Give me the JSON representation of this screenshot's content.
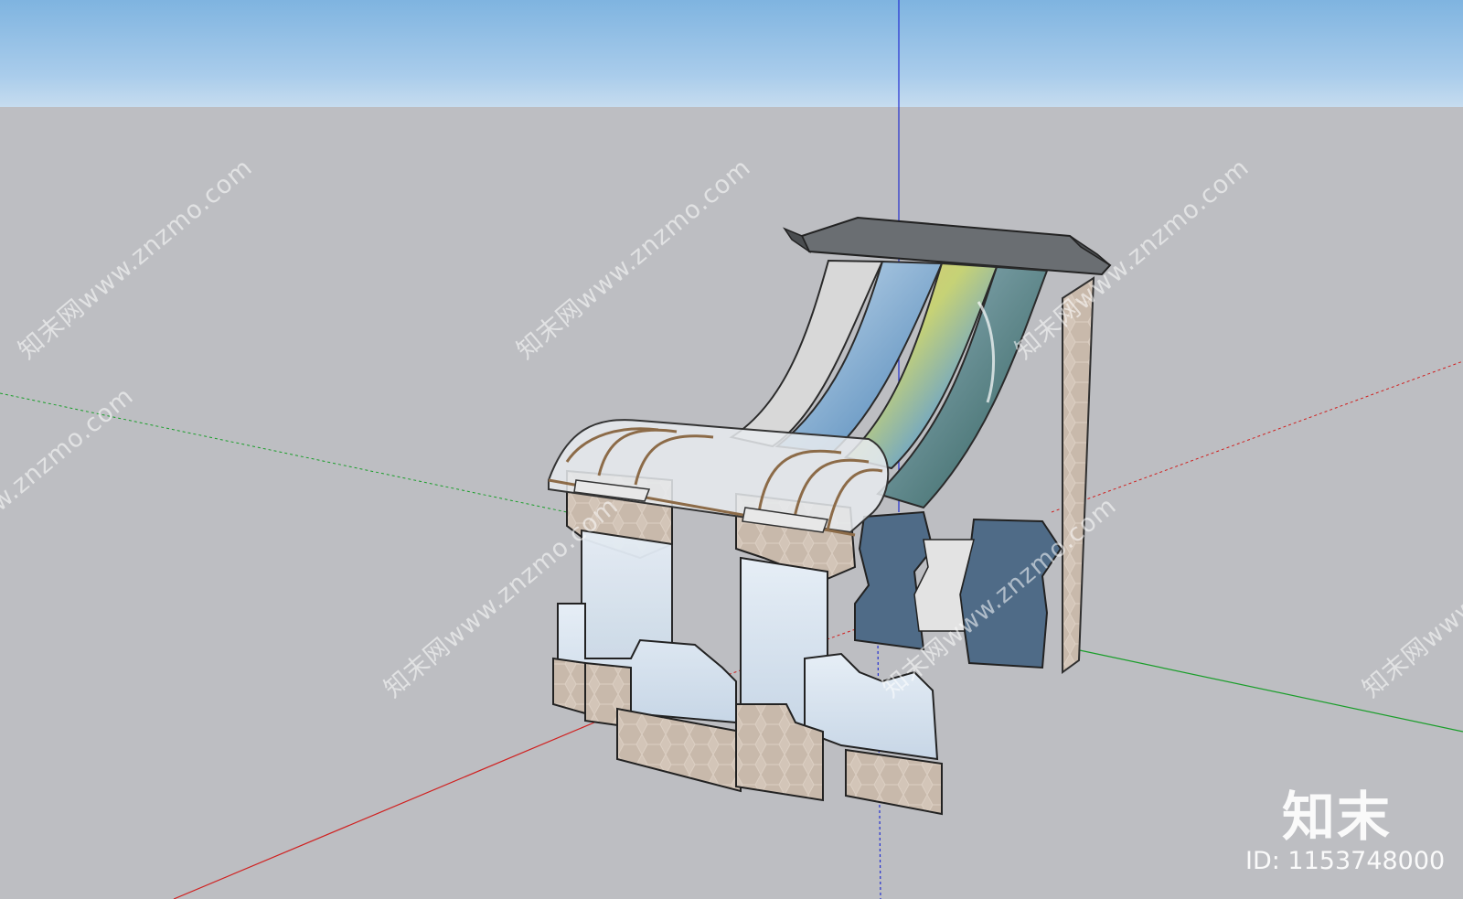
{
  "watermark": {
    "site_text": "知末网www.znzmo.com",
    "brand": "知末",
    "id_text": "ID: 1153748000"
  },
  "colors": {
    "sky": "#8fc0e8",
    "ground": "#bdbec2",
    "axis_red": "#d0201f",
    "axis_green": "#1a9e2a",
    "axis_blue": "#2430d0",
    "stone": "#cfc1b4",
    "glass": "#d9e4ef",
    "roof_tile": "#6c7074",
    "blue_block": "#4f6b87"
  },
  "icons": {
    "model": "3d-garden-wall-model",
    "axes": "model-axes"
  }
}
